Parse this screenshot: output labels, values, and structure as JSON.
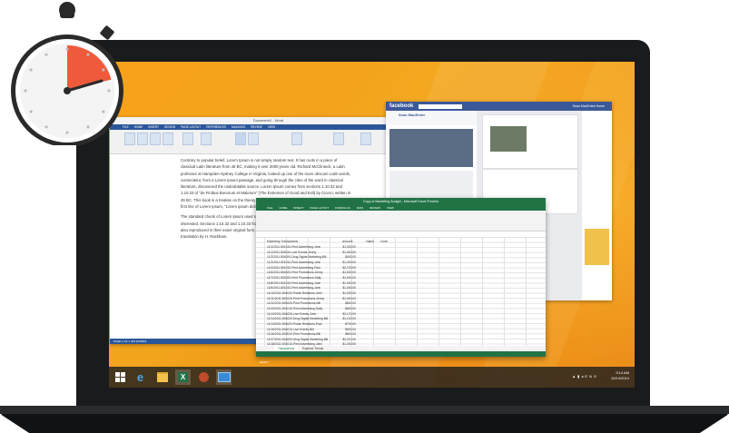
{
  "word": {
    "title": "Document1 - Word",
    "tabs": [
      "FILE",
      "HOME",
      "INSERT",
      "DESIGN",
      "PAGE LAYOUT",
      "REFERENCES",
      "MAILINGS",
      "REVIEW",
      "VIEW"
    ],
    "paragraph1": "Contrary to popular belief, Lorem Ipsum is not simply random text. It has roots in a piece of classical Latin literature from 45 BC, making it over 2000 years old. Richard McClintock, a Latin professor at Hampden-Sydney College in Virginia, looked up one of the more obscure Latin words, consectetur, from a Lorem Ipsum passage, and going through the cites of the word in classical literature, discovered the undoubtable source. Lorem Ipsum comes from sections 1.10.32 and 1.10.33 of \"de Finibus Bonorum et Malorum\" (The Extremes of Good and Evil) by Cicero, written in 45 BC. This book is a treatise on the theory of ethics, very popular during the Renaissance. The first line of Lorem Ipsum, \"Lorem ipsum dolor sit amet..\", comes from a line in section 1.10.32.",
    "paragraph2": "The standard chunk of Lorem Ipsum used since the 1500s is reproduced below for those interested. Sections 1.10.32 and 1.10.33 from \"de Finibus Bonorum et Malorum\" by Cicero are also reproduced in their exact original form, accompanied by English versions from the 1914 translation by H. Rackham.",
    "status": "PAGE 1 OF 1    449 WORDS"
  },
  "facebook": {
    "logo": "facebook",
    "user": "Sean MacEntee",
    "nav_user": "Sean MacEntee   Home"
  },
  "excel": {
    "title": "Copy of Marketing Budget - Microsoft Excel Preview",
    "tabs": [
      "FILE",
      "HOME",
      "INSERT",
      "PAGE LAYOUT",
      "FORMULAS",
      "DATA",
      "REVIEW",
      "VIEW"
    ],
    "headers": {
      "col_a": "Marketing Transactions",
      "col_b": "Amount",
      "col_c": "Name",
      "col_d": "Code"
    },
    "rows": [
      {
        "date": "11/1/2011",
        "desc": "801010-Print Advertising-John",
        "amount": "$1,000.00"
      },
      {
        "date": "11/1/2011",
        "desc": "804010-Live Events-Jenny",
        "amount": "$1,000.00"
      },
      {
        "date": "11/2/2011",
        "desc": "804020-Drug Digital Marketing-Bill",
        "amount": "$400.00"
      },
      {
        "date": "11/3/2011",
        "desc": "801010-Print Advertising-John",
        "amount": "$1,000.00"
      },
      {
        "date": "11/4/2011",
        "desc": "801010-Print Advertising-Paul",
        "amount": "$2,700.00"
      },
      {
        "date": "11/6/2011",
        "desc": "804020-Print Promotions-Jenny",
        "amount": "$1,600.00"
      },
      {
        "date": "11/7/2011",
        "desc": "802020-Print Promotions-Sally",
        "amount": "$1,000.00"
      },
      {
        "date": "11/8/2011",
        "desc": "801010-Print Advertising-John",
        "amount": "$1,000.00"
      },
      {
        "date": "11/9/2011",
        "desc": "801010-Print Advertising-John",
        "amount": "$1,000.00"
      },
      {
        "date": "11/10/2011",
        "desc": "804020-Public Relations-John",
        "amount": "$1,000.00"
      },
      {
        "date": "11/11/2011",
        "desc": "802020-Print Promotions-Jenny",
        "amount": "$1,000.00"
      },
      {
        "date": "11/12/2011",
        "desc": "804020-Print Promotions-Bill",
        "amount": "$800.00"
      },
      {
        "date": "11/13/2011",
        "desc": "801010-Print Advertising-Sally",
        "amount": "$600.00"
      },
      {
        "date": "11/13/2011",
        "desc": "804020-Live Events-John",
        "amount": "$2,170.00"
      },
      {
        "date": "11/14/2011",
        "desc": "804020-Drug Digital Marketing-Bill",
        "amount": "$1,100.00"
      },
      {
        "date": "11/14/2011",
        "desc": "804020-Public Relations-Paul",
        "amount": "$700.00"
      },
      {
        "date": "11/15/2011",
        "desc": "804010-Live Events-Bill",
        "amount": "$500.00"
      },
      {
        "date": "11/16/2011",
        "desc": "802010-Print Promotions-Bill",
        "amount": "$800.00"
      },
      {
        "date": "11/17/2011",
        "desc": "804020-Drug Digital Marketing-Bill",
        "amount": "$2,210.00"
      },
      {
        "date": "11/18/2011",
        "desc": "801010-Print Advertising-John",
        "amount": "$1,200.00"
      },
      {
        "date": "11/19/2011",
        "desc": "804010-Drug Digital Marketing-Bill",
        "amount": "$1,000.00"
      },
      {
        "date": "11/20/2011",
        "desc": "804020-Live Events-Paul",
        "amount": "$1,000.00"
      }
    ],
    "sheets": [
      "Transactions",
      "Expense Trends"
    ],
    "status": "READY"
  },
  "taskbar": {
    "time": "9:14 AM",
    "date": "10/14/2014",
    "lang": "ENG"
  },
  "colors": {
    "accent_orange": "#f2a41d",
    "word_blue": "#2b579a",
    "excel_green": "#217346",
    "fb_blue": "#3b5998",
    "stopwatch_red": "#ee5a3b"
  }
}
